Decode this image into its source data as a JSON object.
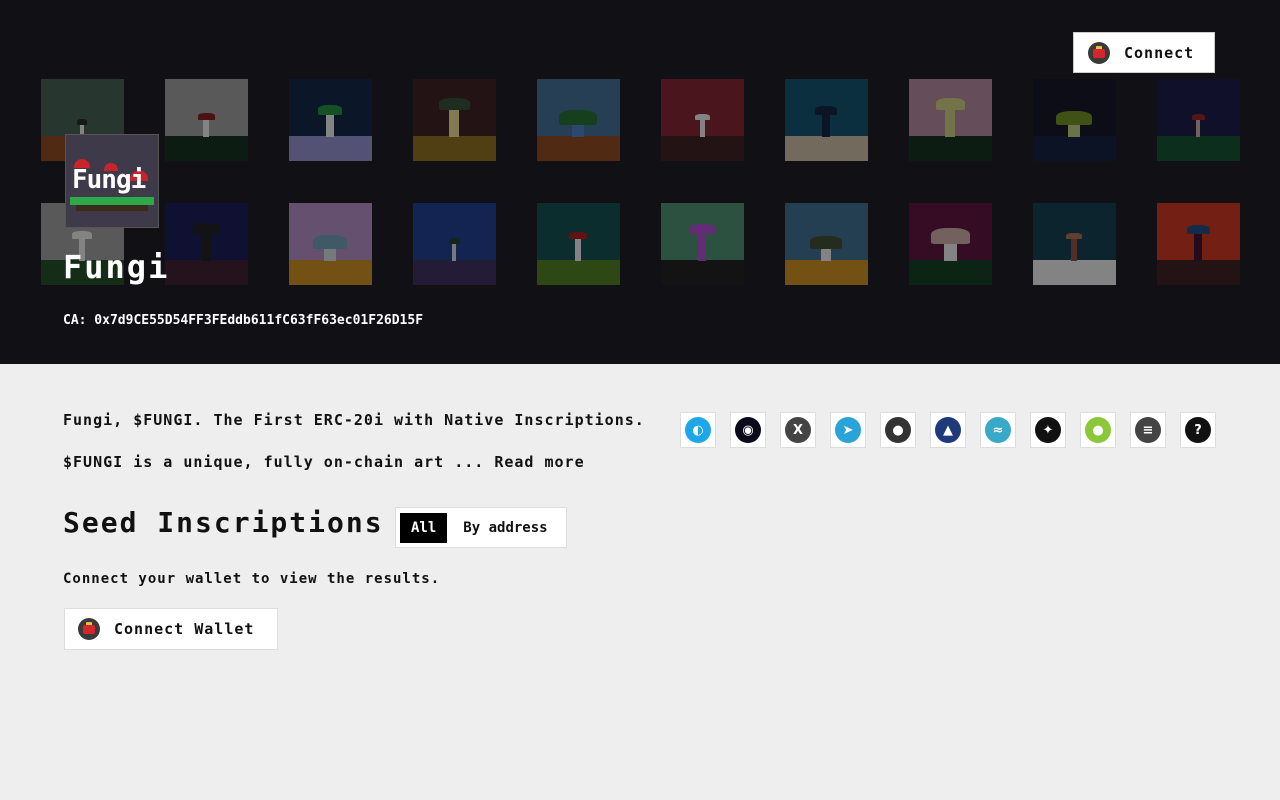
{
  "header": {
    "connect_label": "Connect",
    "title": "Fungi",
    "logo_text": "Fungi",
    "contract": "CA: 0x7d9CE55D54FF3FEddb611fC63fF63ec01F26D15F"
  },
  "tiles": [
    {
      "sky": "#3f5a49",
      "ground": "#8a4418",
      "cap": "#222",
      "stem": "#e6e6e6"
    },
    {
      "sky": "#9a9a9a",
      "ground": "#0e2a16",
      "cap": "#7e1818",
      "stem": "#e6e6e6"
    },
    {
      "sky": "#0e2040",
      "ground": "#8e8cc8",
      "cap": "#1e8a3a",
      "stem": "#e6e6e6"
    },
    {
      "sky": "#3a1a1a",
      "ground": "#8a6a1a",
      "cap": "#2e4a2e",
      "stem": "#e6d68a"
    },
    {
      "sky": "#3e6a90",
      "ground": "#8a4418",
      "cap": "#1e6a2a",
      "stem": "#4a7ac0"
    },
    {
      "sky": "#7e1e2a",
      "ground": "#3a1a1a",
      "cap": "#e6e6e6",
      "stem": "#e6e6e6"
    },
    {
      "sky": "#0e4e68",
      "ground": "#c8b8a0",
      "cap": "#0e1e3a",
      "stem": "#0e1e3a"
    },
    {
      "sky": "#b0849a",
      "ground": "#0e2a16",
      "cap": "#c8c878",
      "stem": "#c8c878"
    },
    {
      "sky": "#0e1020",
      "ground": "#0e1a3a",
      "cap": "#6a8a1a",
      "stem": "#b8c878"
    },
    {
      "sky": "#141444",
      "ground": "#0e4e2a",
      "cap": "#8e1e1e",
      "stem": "#c8a8a0"
    },
    {
      "sky": "#9a9a9a",
      "ground": "#1e4a1e",
      "cap": "#e6e6e6",
      "stem": "#e6e6e6"
    },
    {
      "sky": "#141450",
      "ground": "#3a1a2a",
      "cap": "#1a1a1a",
      "stem": "#1a1a1a"
    },
    {
      "sky": "#b08ac0",
      "ground": "#c88a1a",
      "cap": "#6a9ab0",
      "stem": "#c8d8d8"
    },
    {
      "sky": "#1a3a8a",
      "ground": "#3a2a5a",
      "cap": "#1e3a2a",
      "stem": "#c8d8d8"
    },
    {
      "sky": "#0e4a4a",
      "ground": "#4a7a1a",
      "cap": "#a81a1a",
      "stem": "#e6e6e6"
    },
    {
      "sky": "#4a8a6a",
      "ground": "#1a1a1a",
      "cap": "#a84ac8",
      "stem": "#a84ac8"
    },
    {
      "sky": "#3a6a8a",
      "ground": "#c88a1a",
      "cap": "#3a4a2a",
      "stem": "#e6e6e6"
    },
    {
      "sky": "#5a0e3a",
      "ground": "#0e3a1a",
      "cap": "#c8a8a0",
      "stem": "#e6e6e6"
    },
    {
      "sky": "#0e3a4a",
      "ground": "#e6e6e6",
      "cap": "#a86a4a",
      "stem": "#8a4a3a"
    },
    {
      "sky": "#c8301a",
      "ground": "#3a1a1a",
      "cap": "#1a4a7a",
      "stem": "#3a0e2a"
    }
  ],
  "main": {
    "tagline": "Fungi, $FUNGI. The First ERC-20i with Native Inscriptions.",
    "desc_text": "$FUNGI is a unique, fully on-chain art ... ",
    "read_more": "Read more",
    "section_title": "Seed Inscriptions",
    "filter_all": "All",
    "filter_by_address": "By address",
    "hint": "Connect your wallet to view the results.",
    "connect_wallet_label": "Connect Wallet"
  },
  "socials": [
    {
      "icon": "uniswap-icon",
      "glyph": "◐",
      "bg": "#1ea7e8"
    },
    {
      "icon": "dextools-icon",
      "glyph": "◉",
      "bg": "#0a0a1a"
    },
    {
      "icon": "x-twitter-icon",
      "glyph": "X",
      "bg": "#444"
    },
    {
      "icon": "telegram-icon",
      "glyph": "➤",
      "bg": "#2aa3d8"
    },
    {
      "icon": "github-icon",
      "glyph": "●",
      "bg": "#333"
    },
    {
      "icon": "dexscreener-icon",
      "glyph": "▲",
      "bg": "#1e3a7a"
    },
    {
      "icon": "coingecko-icon",
      "glyph": "≈",
      "bg": "#3aa8c8"
    },
    {
      "icon": "wolf-icon",
      "glyph": "✦",
      "bg": "#111"
    },
    {
      "icon": "gecko-icon",
      "glyph": "●",
      "bg": "#8ac83a"
    },
    {
      "icon": "docs-icon",
      "glyph": "≡",
      "bg": "#444"
    },
    {
      "icon": "help-icon",
      "glyph": "?",
      "bg": "#111"
    }
  ],
  "colors": {
    "hero_bg": "#111015",
    "page_bg": "#eeeeee",
    "accent": "#000000"
  }
}
